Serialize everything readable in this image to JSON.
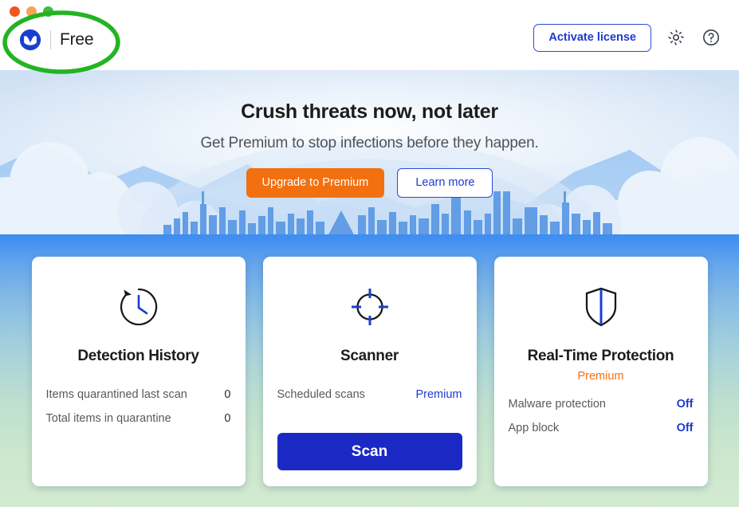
{
  "window": {
    "traffic_lights": [
      {
        "name": "close",
        "color": "#f0561d"
      },
      {
        "name": "minimize",
        "color": "#f5a354"
      },
      {
        "name": "maximize",
        "color": "#3fbb3f"
      }
    ]
  },
  "header": {
    "logo_icon": "malwarebytes-logo-icon",
    "edition": "Free",
    "activate_label": "Activate license",
    "settings_icon": "gear-icon",
    "help_icon": "help-icon"
  },
  "hero": {
    "title": "Crush threats now, not later",
    "subtitle": "Get Premium to stop infections before they happen.",
    "upgrade_label": "Upgrade to Premium",
    "learn_label": "Learn more"
  },
  "cards": [
    {
      "icon": "clock-history-icon",
      "title": "Detection History",
      "badge": null,
      "rows": [
        {
          "label": "Items quarantined last scan",
          "value": "0",
          "style": "plain"
        },
        {
          "label": "Total items in quarantine",
          "value": "0",
          "style": "plain"
        }
      ],
      "action": null
    },
    {
      "icon": "crosshair-scanner-icon",
      "title": "Scanner",
      "badge": null,
      "rows": [
        {
          "label": "Scheduled scans",
          "value": "Premium",
          "style": "link"
        }
      ],
      "action": "Scan"
    },
    {
      "icon": "shield-icon",
      "title": "Real-Time Protection",
      "badge": "Premium",
      "rows": [
        {
          "label": "Malware protection",
          "value": "Off",
          "style": "status"
        },
        {
          "label": "App block",
          "value": "Off",
          "style": "status"
        }
      ],
      "action": null
    }
  ],
  "annotation": {
    "shape": "ellipse-highlight",
    "color": "#22b422"
  },
  "colors": {
    "brand_blue": "#1a29c4",
    "link_blue": "#1e3ad1",
    "accent_orange": "#f2700f",
    "annotation_green": "#22b422"
  }
}
